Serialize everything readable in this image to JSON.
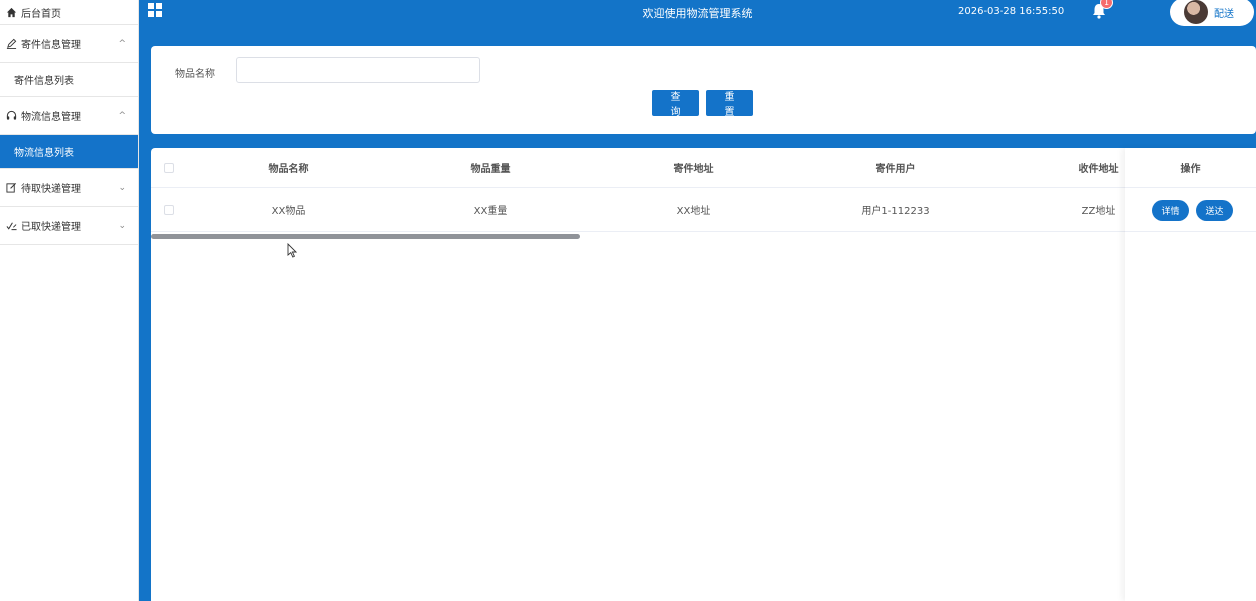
{
  "sidebar": {
    "home": "后台首页",
    "groups": [
      {
        "label": "寄件信息管理",
        "expanded": true,
        "children": [
          "寄件信息列表"
        ]
      },
      {
        "label": "物流信息管理",
        "expanded": true,
        "children": [
          "物流信息列表"
        ]
      },
      {
        "label": "待取快递管理",
        "expanded": false,
        "children": []
      },
      {
        "label": "已取快递管理",
        "expanded": false,
        "children": []
      }
    ],
    "active_item": "物流信息列表"
  },
  "header": {
    "title": "欢迎使用物流管理系统",
    "datetime": "2026-03-28 16:55:50",
    "notification_count": "1",
    "user_name": "配送"
  },
  "search": {
    "label": "物品名称",
    "value": "",
    "placeholder": "",
    "query_button": "查询",
    "reset_button": "重置"
  },
  "table": {
    "columns": [
      "物品名称",
      "物品重量",
      "寄件地址",
      "寄件用户",
      "收件地址",
      "操作"
    ],
    "rows": [
      {
        "name": "XX物品",
        "weight": "XX重量",
        "sender_address": "XX地址",
        "sender_user": "用户1-112233",
        "receiver_address": "ZZ地址"
      }
    ],
    "actions": [
      "详情",
      "送达"
    ]
  },
  "colors": {
    "primary": "#1374c8",
    "button": "#1473c9",
    "badge": "#f56c6c"
  }
}
